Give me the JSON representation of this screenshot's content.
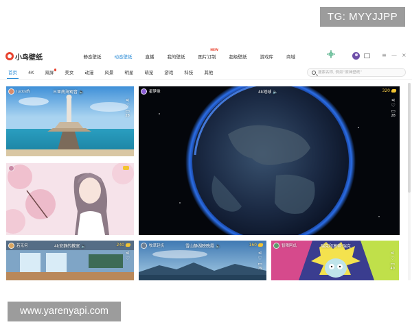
{
  "watermarks": {
    "tg": "TG: MYYJJPP",
    "site": "www.yarenyapi.com"
  },
  "app": {
    "logo_text": "小鸟壁纸",
    "nav": [
      {
        "label": "静态壁纸",
        "active": false
      },
      {
        "label": "动态壁纸",
        "active": true
      },
      {
        "label": "直播",
        "active": false
      },
      {
        "label": "我的壁纸",
        "active": false
      },
      {
        "label": "图片订制",
        "active": false,
        "badge": "NEW"
      },
      {
        "label": "超级壁纸",
        "active": false
      },
      {
        "label": "游戏库",
        "active": false
      },
      {
        "label": "商城",
        "active": false
      }
    ],
    "window_controls": [
      "≡",
      "—",
      "×"
    ]
  },
  "categories": [
    {
      "label": "首页",
      "active": true
    },
    {
      "label": "4K"
    },
    {
      "label": "双屏",
      "dot": true
    },
    {
      "label": "美女"
    },
    {
      "label": "动漫"
    },
    {
      "label": "风景"
    },
    {
      "label": "明星"
    },
    {
      "label": "萌宠"
    },
    {
      "label": "游戏"
    },
    {
      "label": "科技"
    },
    {
      "label": "其他"
    }
  ],
  "search": {
    "placeholder": "搜索名称, 例如“原神壁纸”"
  },
  "cards": [
    {
      "name": "card-guanyin",
      "user": "lucky的",
      "title": "三亚南海观音",
      "likes": "",
      "comments": "28"
    },
    {
      "name": "card-earth",
      "user": "星梦缘",
      "title": "4k地球",
      "likes": "320",
      "comments": "28"
    },
    {
      "name": "card-anime-girl",
      "user": "",
      "title": "",
      "likes": "",
      "comments": ""
    },
    {
      "name": "card-classroom",
      "user": "若无何",
      "title": "4k安静的教室",
      "likes": "240",
      "comments": ""
    },
    {
      "name": "card-snow-mountain",
      "user": "牧草轻抚",
      "title": "雪山静湖映晚霞",
      "likes": "160",
      "comments": "79"
    },
    {
      "name": "card-rick",
      "user": "智障阿瓜",
      "title": "瑞克和莫蒂·瑞克",
      "likes": "",
      "comments": "40"
    }
  ],
  "colors": {
    "accent": "#2a8bd6",
    "badge_red": "#e8432f",
    "coin_gold": "#f3c431"
  }
}
